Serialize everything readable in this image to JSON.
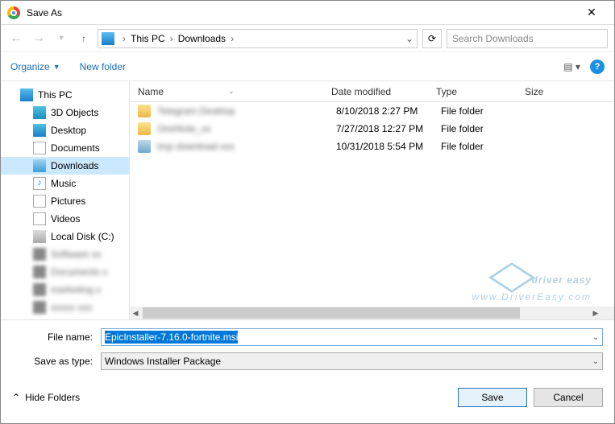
{
  "title": "Save As",
  "breadcrumb": {
    "root": "This PC",
    "folder": "Downloads"
  },
  "search": {
    "placeholder": "Search Downloads"
  },
  "toolbar": {
    "organize": "Organize",
    "newfolder": "New folder"
  },
  "sidebar": {
    "items": [
      {
        "label": "This PC"
      },
      {
        "label": "3D Objects"
      },
      {
        "label": "Desktop"
      },
      {
        "label": "Documents"
      },
      {
        "label": "Downloads"
      },
      {
        "label": "Music"
      },
      {
        "label": "Pictures"
      },
      {
        "label": "Videos"
      },
      {
        "label": "Local Disk (C:)"
      }
    ]
  },
  "columns": {
    "name": "Name",
    "date": "Date modified",
    "type": "Type",
    "size": "Size"
  },
  "files": [
    {
      "date": "8/10/2018 2:27 PM",
      "type": "File folder"
    },
    {
      "date": "7/27/2018 12:27 PM",
      "type": "File folder"
    },
    {
      "date": "10/31/2018 5:54 PM",
      "type": "File folder"
    }
  ],
  "form": {
    "filename_label": "File name:",
    "filename_value": "EpicInstaller-7.16.0-fortnite.msi",
    "savetype_label": "Save as type:",
    "savetype_value": "Windows Installer Package"
  },
  "footer": {
    "hide": "Hide Folders",
    "save": "Save",
    "cancel": "Cancel"
  },
  "watermark": {
    "brand": "driver easy",
    "url": "www.DriverEasy.com"
  }
}
